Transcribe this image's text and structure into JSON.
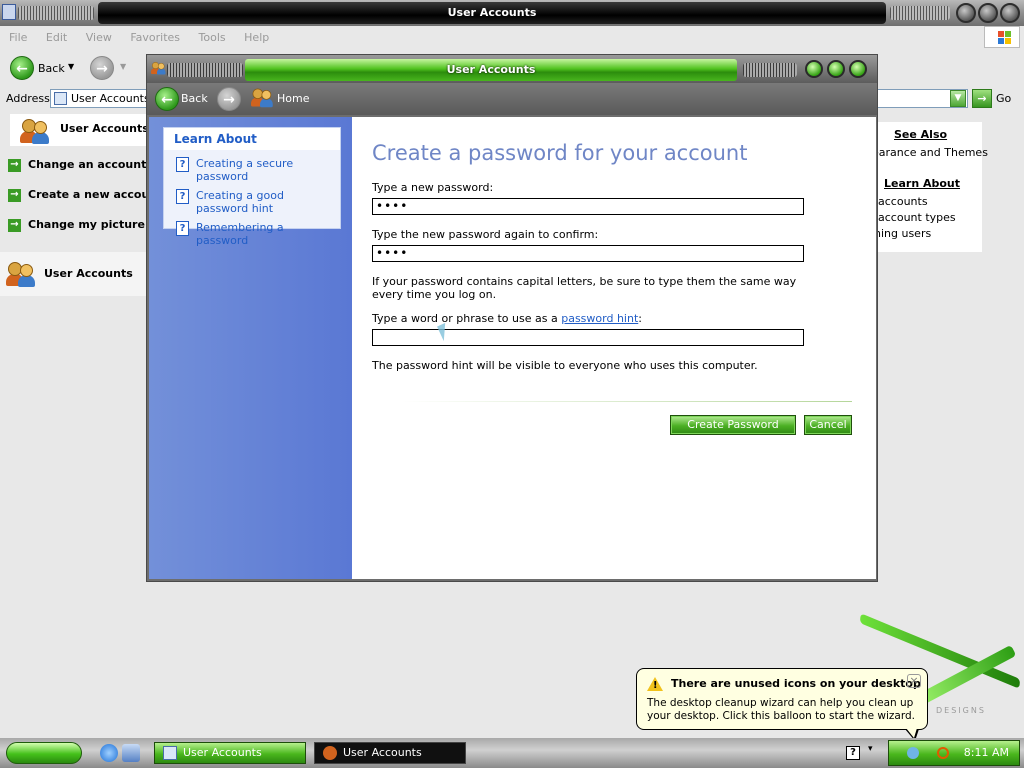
{
  "outer": {
    "title": "User Accounts",
    "menu": [
      "File",
      "Edit",
      "View",
      "Favorites",
      "Tools",
      "Help"
    ],
    "back_label": "Back",
    "address_label": "Address",
    "address_value": "User Accounts",
    "go_label": "Go",
    "left_pane": {
      "box_label": "User Accounts",
      "tasks": [
        "Change an account",
        "Create a new account",
        "Change my picture"
      ],
      "section_label": "User Accounts"
    },
    "right_pane": {
      "see_also_heading": "See Also",
      "see_also_item": "earance and Themes",
      "learn_about_heading": "Learn About",
      "learn_items": [
        "accounts",
        "account types",
        "hing users"
      ]
    }
  },
  "inner": {
    "title": "User Accounts",
    "back_label": "Back",
    "home_label": "Home",
    "learn_about": {
      "heading": "Learn About",
      "items": [
        "Creating a secure password",
        "Creating a good password hint",
        "Remembering a password"
      ]
    },
    "main": {
      "title": "Create a password for your account",
      "new_password_label": "Type a new password:",
      "new_password_value": "••••",
      "confirm_label": "Type the new password again to confirm:",
      "confirm_value": "••••",
      "caps_note": "If your password contains capital letters, be sure to type them the same way every time you log on.",
      "hint_label_prefix": "Type a word or phrase to use as a ",
      "hint_link": "password hint",
      "hint_label_suffix": ":",
      "hint_value": "",
      "hint_note": "The password hint will be visible to everyone who uses this computer.",
      "create_button": "Create Password",
      "cancel_button": "Cancel"
    }
  },
  "balloon": {
    "title": "There are unused icons on your desktop",
    "body": "The desktop cleanup wizard can help you clean up your desktop. Click this balloon to start the wizard."
  },
  "taskbar": {
    "buttons": [
      "User Accounts",
      "User Accounts"
    ],
    "clock": "8:11 AM",
    "help_icon": "?"
  },
  "brand": {
    "logo_text": "DESIGNS"
  },
  "colors": {
    "accent_green": "#4bb023",
    "link_blue": "#215dc6",
    "title_blue": "#6f86c6"
  }
}
